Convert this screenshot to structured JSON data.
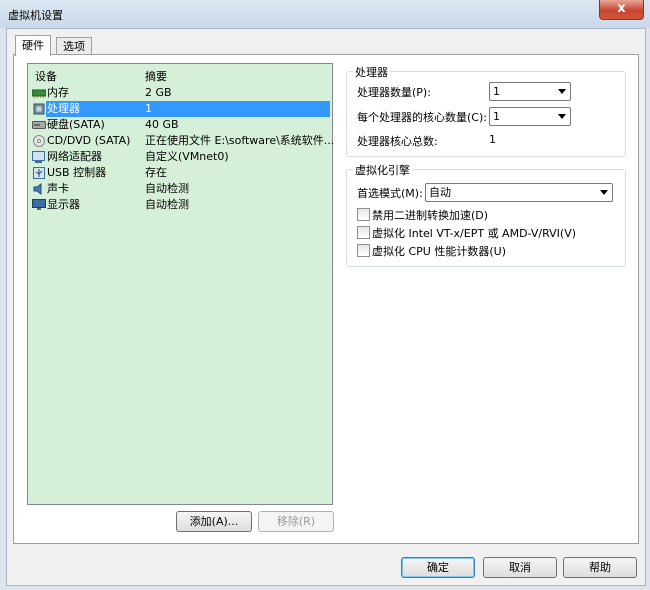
{
  "window": {
    "title": "虚拟机设置",
    "close_glyph": "x"
  },
  "tabs": [
    {
      "label": "硬件"
    },
    {
      "label": "选项"
    }
  ],
  "device_list": {
    "headers": {
      "device": "设备",
      "summary": "摘要"
    },
    "rows": [
      {
        "name": "内存",
        "summary": "2 GB",
        "icon": "memory-icon",
        "selected": false
      },
      {
        "name": "处理器",
        "summary": "1",
        "icon": "processor-icon",
        "selected": true
      },
      {
        "name": "硬盘(SATA)",
        "summary": "40 GB",
        "icon": "hard-disk-icon",
        "selected": false
      },
      {
        "name": "CD/DVD (SATA)",
        "summary": "正在使用文件 E:\\software\\系统软件...",
        "icon": "cd-dvd-icon",
        "selected": false
      },
      {
        "name": "网络适配器",
        "summary": "自定义(VMnet0)",
        "icon": "network-adapter-icon",
        "selected": false
      },
      {
        "name": "USB 控制器",
        "summary": "存在",
        "icon": "usb-icon",
        "selected": false
      },
      {
        "name": "声卡",
        "summary": "自动检测",
        "icon": "sound-card-icon",
        "selected": false
      },
      {
        "name": "显示器",
        "summary": "自动检测",
        "icon": "display-icon",
        "selected": false
      }
    ],
    "add_button": "添加(A)...",
    "remove_button": "移除(R)"
  },
  "processor": {
    "group_title": "处理器",
    "count_label": "处理器数量(P):",
    "count_value": "1",
    "cores_label": "每个处理器的核心数量(C):",
    "cores_value": "1",
    "total_label": "处理器核心总数:",
    "total_value": "1"
  },
  "virtualization": {
    "group_title": "虚拟化引擎",
    "mode_label": "首选模式(M):",
    "mode_value": "自动",
    "options": [
      {
        "label": "禁用二进制转换加速(D)",
        "checked": false
      },
      {
        "label": "虚拟化 Intel VT-x/EPT 或 AMD-V/RVI(V)",
        "checked": false
      },
      {
        "label": "虚拟化 CPU 性能计数器(U)",
        "checked": false
      }
    ]
  },
  "buttons": {
    "ok": "确定",
    "cancel": "取消",
    "help": "帮助"
  }
}
